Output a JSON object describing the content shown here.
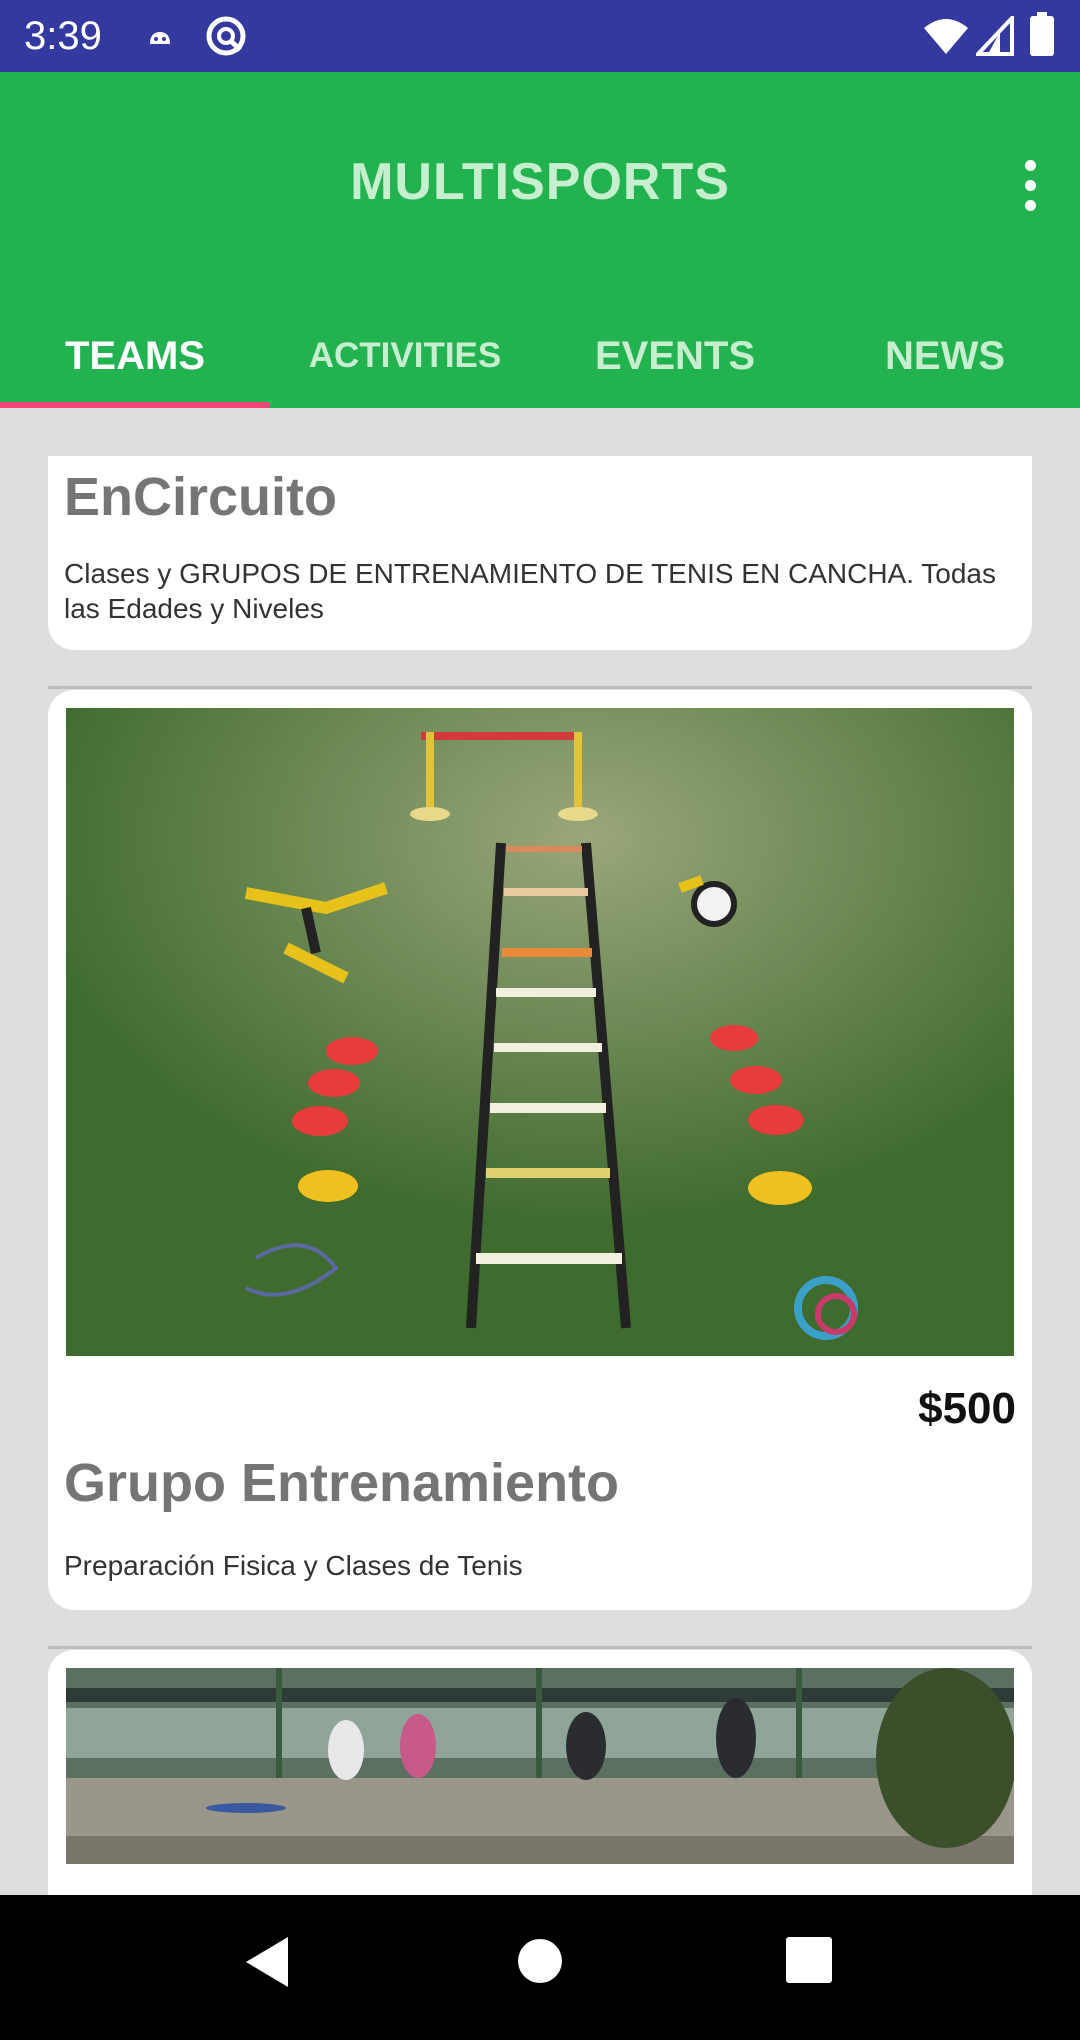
{
  "status_bar": {
    "time": "3:39",
    "icons": [
      "android-debug-icon",
      "sync-icon",
      "wifi-icon",
      "cell-signal-icon",
      "battery-icon"
    ]
  },
  "app_bar": {
    "title": "MULTISPORTS",
    "menu_icon": "more-vert-icon"
  },
  "tabs": [
    {
      "label": "TEAMS",
      "active": true
    },
    {
      "label": "ACTIVITIES",
      "active": false
    },
    {
      "label": "EVENTS",
      "active": false
    },
    {
      "label": "NEWS",
      "active": false
    }
  ],
  "cards": [
    {
      "title": "EnCircuito",
      "description": "Clases y GRUPOS DE ENTRENAMIENTO DE TENIS EN CANCHA. Todas las Edades y Niveles"
    },
    {
      "image": "training-equipment-photo",
      "price": "$500",
      "title": "Grupo Entrenamiento",
      "description": "Preparación Fisica y Clases de Tenis"
    },
    {
      "image": "tennis-court-group-photo"
    }
  ],
  "nav_bar": {
    "buttons": [
      "back-icon",
      "home-icon",
      "recents-icon"
    ]
  },
  "colors": {
    "status_bar": "#33399e",
    "app_bar": "#22b24f",
    "tab_indicator": "#f2467b",
    "background": "#dedede"
  }
}
